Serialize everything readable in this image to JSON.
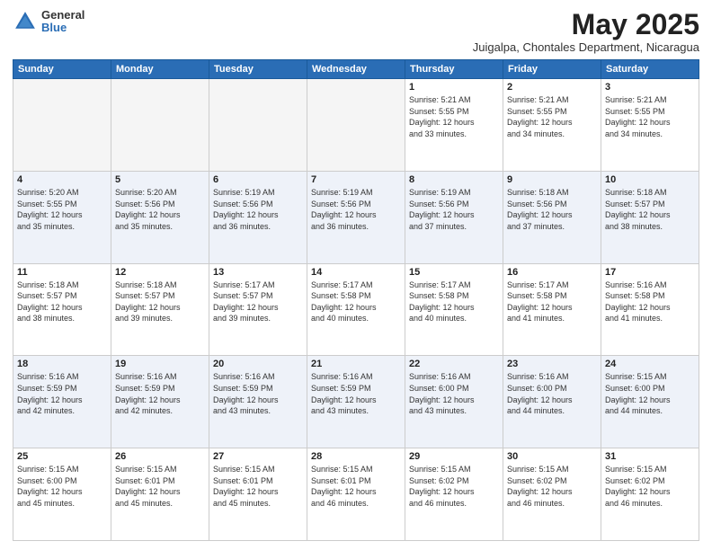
{
  "logo": {
    "general": "General",
    "blue": "Blue"
  },
  "header": {
    "month": "May 2025",
    "location": "Juigalpa, Chontales Department, Nicaragua"
  },
  "weekdays": [
    "Sunday",
    "Monday",
    "Tuesday",
    "Wednesday",
    "Thursday",
    "Friday",
    "Saturday"
  ],
  "weeks": [
    [
      {
        "day": "",
        "info": ""
      },
      {
        "day": "",
        "info": ""
      },
      {
        "day": "",
        "info": ""
      },
      {
        "day": "",
        "info": ""
      },
      {
        "day": "1",
        "info": "Sunrise: 5:21 AM\nSunset: 5:55 PM\nDaylight: 12 hours\nand 33 minutes."
      },
      {
        "day": "2",
        "info": "Sunrise: 5:21 AM\nSunset: 5:55 PM\nDaylight: 12 hours\nand 34 minutes."
      },
      {
        "day": "3",
        "info": "Sunrise: 5:21 AM\nSunset: 5:55 PM\nDaylight: 12 hours\nand 34 minutes."
      }
    ],
    [
      {
        "day": "4",
        "info": "Sunrise: 5:20 AM\nSunset: 5:55 PM\nDaylight: 12 hours\nand 35 minutes."
      },
      {
        "day": "5",
        "info": "Sunrise: 5:20 AM\nSunset: 5:56 PM\nDaylight: 12 hours\nand 35 minutes."
      },
      {
        "day": "6",
        "info": "Sunrise: 5:19 AM\nSunset: 5:56 PM\nDaylight: 12 hours\nand 36 minutes."
      },
      {
        "day": "7",
        "info": "Sunrise: 5:19 AM\nSunset: 5:56 PM\nDaylight: 12 hours\nand 36 minutes."
      },
      {
        "day": "8",
        "info": "Sunrise: 5:19 AM\nSunset: 5:56 PM\nDaylight: 12 hours\nand 37 minutes."
      },
      {
        "day": "9",
        "info": "Sunrise: 5:18 AM\nSunset: 5:56 PM\nDaylight: 12 hours\nand 37 minutes."
      },
      {
        "day": "10",
        "info": "Sunrise: 5:18 AM\nSunset: 5:57 PM\nDaylight: 12 hours\nand 38 minutes."
      }
    ],
    [
      {
        "day": "11",
        "info": "Sunrise: 5:18 AM\nSunset: 5:57 PM\nDaylight: 12 hours\nand 38 minutes."
      },
      {
        "day": "12",
        "info": "Sunrise: 5:18 AM\nSunset: 5:57 PM\nDaylight: 12 hours\nand 39 minutes."
      },
      {
        "day": "13",
        "info": "Sunrise: 5:17 AM\nSunset: 5:57 PM\nDaylight: 12 hours\nand 39 minutes."
      },
      {
        "day": "14",
        "info": "Sunrise: 5:17 AM\nSunset: 5:58 PM\nDaylight: 12 hours\nand 40 minutes."
      },
      {
        "day": "15",
        "info": "Sunrise: 5:17 AM\nSunset: 5:58 PM\nDaylight: 12 hours\nand 40 minutes."
      },
      {
        "day": "16",
        "info": "Sunrise: 5:17 AM\nSunset: 5:58 PM\nDaylight: 12 hours\nand 41 minutes."
      },
      {
        "day": "17",
        "info": "Sunrise: 5:16 AM\nSunset: 5:58 PM\nDaylight: 12 hours\nand 41 minutes."
      }
    ],
    [
      {
        "day": "18",
        "info": "Sunrise: 5:16 AM\nSunset: 5:59 PM\nDaylight: 12 hours\nand 42 minutes."
      },
      {
        "day": "19",
        "info": "Sunrise: 5:16 AM\nSunset: 5:59 PM\nDaylight: 12 hours\nand 42 minutes."
      },
      {
        "day": "20",
        "info": "Sunrise: 5:16 AM\nSunset: 5:59 PM\nDaylight: 12 hours\nand 43 minutes."
      },
      {
        "day": "21",
        "info": "Sunrise: 5:16 AM\nSunset: 5:59 PM\nDaylight: 12 hours\nand 43 minutes."
      },
      {
        "day": "22",
        "info": "Sunrise: 5:16 AM\nSunset: 6:00 PM\nDaylight: 12 hours\nand 43 minutes."
      },
      {
        "day": "23",
        "info": "Sunrise: 5:16 AM\nSunset: 6:00 PM\nDaylight: 12 hours\nand 44 minutes."
      },
      {
        "day": "24",
        "info": "Sunrise: 5:15 AM\nSunset: 6:00 PM\nDaylight: 12 hours\nand 44 minutes."
      }
    ],
    [
      {
        "day": "25",
        "info": "Sunrise: 5:15 AM\nSunset: 6:00 PM\nDaylight: 12 hours\nand 45 minutes."
      },
      {
        "day": "26",
        "info": "Sunrise: 5:15 AM\nSunset: 6:01 PM\nDaylight: 12 hours\nand 45 minutes."
      },
      {
        "day": "27",
        "info": "Sunrise: 5:15 AM\nSunset: 6:01 PM\nDaylight: 12 hours\nand 45 minutes."
      },
      {
        "day": "28",
        "info": "Sunrise: 5:15 AM\nSunset: 6:01 PM\nDaylight: 12 hours\nand 46 minutes."
      },
      {
        "day": "29",
        "info": "Sunrise: 5:15 AM\nSunset: 6:02 PM\nDaylight: 12 hours\nand 46 minutes."
      },
      {
        "day": "30",
        "info": "Sunrise: 5:15 AM\nSunset: 6:02 PM\nDaylight: 12 hours\nand 46 minutes."
      },
      {
        "day": "31",
        "info": "Sunrise: 5:15 AM\nSunset: 6:02 PM\nDaylight: 12 hours\nand 46 minutes."
      }
    ]
  ]
}
